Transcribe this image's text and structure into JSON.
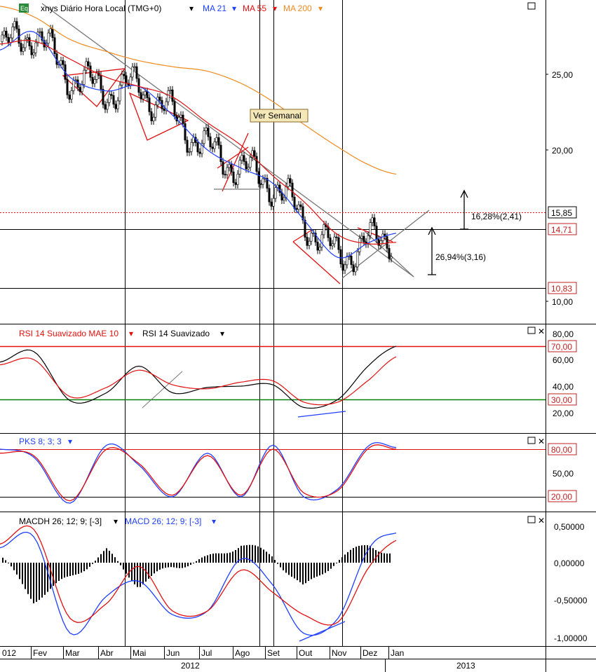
{
  "colors": {
    "ma21": "#1f3fff",
    "ma55": "#e01010",
    "ma200": "#f08a20",
    "rsi": "#000000",
    "rsi_mae": "#e01010",
    "pks_fast": "#1f3fff",
    "pks_slow": "#e01010",
    "macd": "#1f3fff",
    "signal": "#e01010",
    "histogram": "#000000",
    "overbought_line": "#e01010",
    "oversold_line": "#008000",
    "price_line": "#e01010",
    "badge_border": "#c02020"
  },
  "price_panel": {
    "symbol_box": "Eq",
    "title": "xnys Diário Hora Local (TMG+0)",
    "title_arrow": "▾",
    "legend": [
      {
        "label": "MA 21",
        "color_key": "ma21"
      },
      {
        "label": "MA 55",
        "color_key": "ma55"
      },
      {
        "label": "MA 200",
        "color_key": "ma200"
      }
    ],
    "annotation_label": "Ver Semanal",
    "measure_upper": "16,28%(2,41)",
    "measure_lower": "26,94%(3,16)",
    "price_tags": [
      "15,85",
      "14,71",
      "10,83"
    ],
    "y_ticks": [
      "25,00",
      "20,00",
      "10,00"
    ]
  },
  "rsi_panel": {
    "legend": [
      {
        "label": "RSI 14 Suavizado MAE 10",
        "color_key": "rsi_mae"
      },
      {
        "label": "RSI 14 Suavizado",
        "color_key": "rsi"
      }
    ],
    "y_ticks": [
      "80,00",
      "60,00",
      "40,00",
      "20,00"
    ],
    "level_tags": [
      "70,00",
      "30,00"
    ]
  },
  "pks_panel": {
    "legend": [
      {
        "label": "PKS 8; 3; 3",
        "color_key": "pks_fast"
      }
    ],
    "y_ticks": [
      "50,00"
    ],
    "level_tags": [
      "80,00",
      "20,00"
    ]
  },
  "macd_panel": {
    "legend": [
      {
        "label": "MACDH 26; 12; 9; [-3]",
        "color_key": "histogram"
      },
      {
        "label": "MACD 26; 12; 9; [-3]",
        "color_key": "macd"
      }
    ],
    "y_ticks": [
      "0,50000",
      "0,00000",
      "-0,50000",
      "-1,00000"
    ]
  },
  "panel_buttons": {
    "maximize": "□",
    "close": "✕"
  },
  "x_axis": {
    "months": [
      "012",
      "Fev",
      "Mar",
      "Abr",
      "Mai",
      "Jun",
      "Jul",
      "Ago",
      "Set",
      "Out",
      "Nov",
      "Dez",
      "Jan"
    ],
    "years": [
      "2012",
      "2013"
    ]
  },
  "chart_data": [
    {
      "type": "line",
      "title": "xnys Diário Hora Local (TMG+0)",
      "x": [
        "012",
        "Fev",
        "Mar",
        "Abr",
        "Mai",
        "Jun",
        "Jul",
        "Ago",
        "Set",
        "Out",
        "Nov",
        "Dez",
        "Jan"
      ],
      "series": [
        {
          "name": "MA 21",
          "values": [
            26.6,
            27.8,
            24.8,
            23.9,
            24.2,
            22.3,
            20.0,
            18.8,
            17.8,
            15.4,
            12.9,
            13.9,
            14.5
          ]
        },
        {
          "name": "MA 55",
          "values": [
            27.0,
            27.2,
            26.0,
            24.8,
            24.2,
            23.5,
            21.8,
            20.3,
            18.3,
            16.6,
            14.4,
            13.8,
            13.9
          ]
        },
        {
          "name": "MA 200",
          "values": [
            29.5,
            28.8,
            27.3,
            26.5,
            25.9,
            25.5,
            25.2,
            24.4,
            23.2,
            21.7,
            20.2,
            19.0,
            18.4
          ]
        }
      ],
      "price_levels": [
        15.85,
        14.71,
        10.83
      ],
      "ylim": [
        8.5,
        29.5
      ]
    },
    {
      "type": "line",
      "x": [
        "012",
        "Fev",
        "Mar",
        "Abr",
        "Mai",
        "Jun",
        "Jul",
        "Ago",
        "Set",
        "Out",
        "Nov",
        "Dez",
        "Jan"
      ],
      "series": [
        {
          "name": "RSI 14 Suavizado",
          "values": [
            58,
            66,
            29,
            35,
            55,
            35,
            39,
            40,
            41,
            24,
            30,
            56,
            70
          ]
        },
        {
          "name": "RSI 14 Suavizado MAE 10",
          "values": [
            56,
            60,
            32,
            39,
            52,
            41,
            38,
            43,
            44,
            28,
            28,
            45,
            62
          ]
        }
      ],
      "levels": [
        70,
        30
      ],
      "ylim": [
        8,
        82
      ]
    },
    {
      "type": "line",
      "x": [
        "012",
        "Fev",
        "Mar",
        "Abr",
        "Mai",
        "Jun",
        "Jul",
        "Ago",
        "Set",
        "Out",
        "Nov",
        "Dez",
        "Jan"
      ],
      "series": [
        {
          "name": "PKS 8; 3; 3",
          "values": [
            80,
            70,
            12,
            85,
            60,
            20,
            75,
            20,
            85,
            20,
            30,
            85,
            82
          ]
        },
        {
          "values": [
            75,
            72,
            15,
            80,
            62,
            22,
            72,
            22,
            80,
            25,
            28,
            82,
            80
          ]
        }
      ],
      "levels": [
        80,
        20
      ],
      "ylim": [
        0,
        90
      ]
    },
    {
      "type": "line",
      "x": [
        "012",
        "Fev",
        "Mar",
        "Abr",
        "Mai",
        "Jun",
        "Jul",
        "Ago",
        "Set",
        "Out",
        "Nov",
        "Dez",
        "Jan"
      ],
      "series": [
        {
          "name": "MACD 26; 12; 9; [-3]",
          "values": [
            0.2,
            0.35,
            -0.95,
            -0.45,
            -0.25,
            -0.7,
            -0.65,
            0.05,
            -0.3,
            -0.95,
            -0.75,
            0.2,
            0.4
          ]
        },
        {
          "name": "MACDH 26; 12; 9; [-3]",
          "values": [
            0.1,
            -0.5,
            -0.2,
            0.15,
            -0.3,
            -0.05,
            0.05,
            0.25,
            0.1,
            -0.35,
            0.05,
            0.25,
            0.1
          ]
        },
        {
          "values": [
            0.25,
            0.45,
            -0.75,
            -0.55,
            -0.05,
            -0.65,
            -0.65,
            -0.1,
            -0.4,
            -0.7,
            -0.8,
            -0.05,
            0.3
          ]
        }
      ],
      "ylim": [
        -1.1,
        0.6
      ]
    }
  ]
}
